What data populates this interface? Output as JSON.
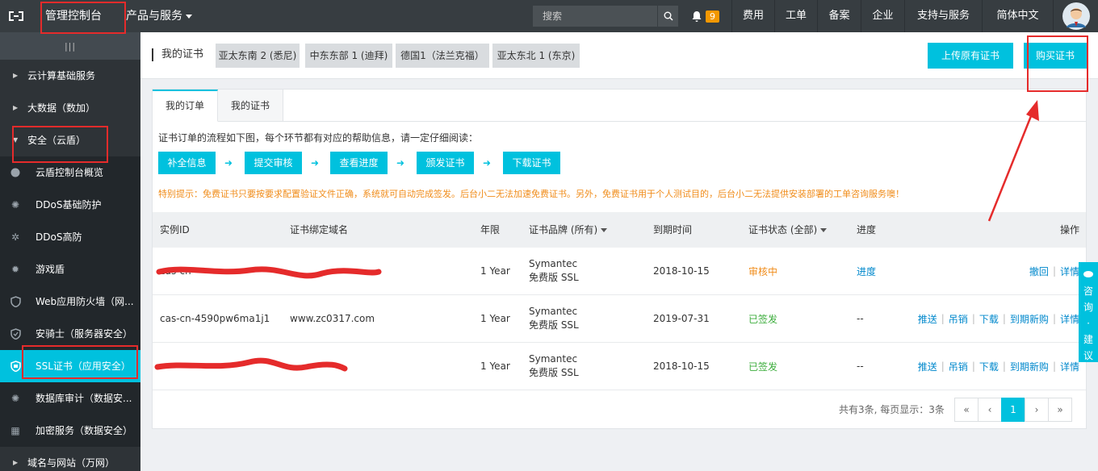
{
  "topbar": {
    "console": "管理控制台",
    "products": "产品与服务",
    "search_placeholder": "搜索",
    "notifications": "9",
    "nav": [
      "费用",
      "工单",
      "备案",
      "企业",
      "支持与服务",
      "简体中文"
    ]
  },
  "sidebar": {
    "groups": {
      "cloud": "云计算基础服务",
      "bigdata": "大数据（数加）",
      "security": "安全（云盾）",
      "domain": "域名与网站（万网）"
    },
    "items": [
      {
        "label": "云盾控制台概览",
        "icon": "circle-icon"
      },
      {
        "label": "DDoS基础防护",
        "icon": "gear-icon"
      },
      {
        "label": "DDoS高防",
        "icon": "gear-icon"
      },
      {
        "label": "游戏盾",
        "icon": "gear-icon"
      },
      {
        "label": "Web应用防火墙（网...",
        "icon": "shield-icon"
      },
      {
        "label": "安骑士（服务器安全）",
        "icon": "shield-icon"
      },
      {
        "label": "SSL证书（应用安全）",
        "icon": "certificate-icon"
      },
      {
        "label": "数据库审计（数据安...",
        "icon": "gear-icon"
      },
      {
        "label": "加密服务（数据安全）",
        "icon": "grid-icon"
      }
    ]
  },
  "page": {
    "title": "我的证书",
    "regions": [
      "亚太东南 2 (悉尼)",
      "中东东部 1 (迪拜)",
      "德国1（法兰克福）",
      "亚太东北 1 (东京)"
    ],
    "upload_button": "上传原有证书",
    "buy_button": "购买证书"
  },
  "tabs": [
    "我的订单",
    "我的证书"
  ],
  "intro": "证书订单的流程如下图，每个环节都有对应的帮助信息，请一定仔细阅读：",
  "steps": [
    "补全信息",
    "提交审核",
    "查看进度",
    "颁发证书",
    "下载证书"
  ],
  "notice": "特别提示：免费证书只要按要求配置验证文件正确，系统就可自动完成签发。后台小二无法加速免费证书。另外，免费证书用于个人测试目的，后台小二无法提供安装部署的工单咨询服务噢！",
  "table": {
    "headers": {
      "id": "实例ID",
      "domain": "证书绑定域名",
      "term": "年限",
      "brand": "证书品牌 (所有)",
      "expire": "到期时间",
      "status": "证书状态 (全部)",
      "progress": "进度",
      "ops": "操作"
    },
    "rows": [
      {
        "id": "cas-cn-",
        "domain": "",
        "term": "1 Year",
        "brand1": "Symantec",
        "brand2": "免费版 SSL",
        "expire": "2018-10-15",
        "status": "审核中",
        "progress": "进度",
        "ops": [
          "撤回",
          "详情"
        ]
      },
      {
        "id": "cas-cn-4590pw6ma1j1",
        "domain": "www.zc0317.com",
        "term": "1 Year",
        "brand1": "Symantec",
        "brand2": "免费版 SSL",
        "expire": "2019-07-31",
        "status": "已签发",
        "progress": "--",
        "ops": [
          "推送",
          "吊销",
          "下载",
          "到期新购",
          "详情"
        ]
      },
      {
        "id": "",
        "domain": "",
        "term": "1 Year",
        "brand1": "Symantec",
        "brand2": "免费版 SSL",
        "expire": "2018-10-15",
        "status": "已签发",
        "progress": "--",
        "ops": [
          "推送",
          "吊销",
          "下载",
          "到期新购",
          "详情"
        ]
      }
    ]
  },
  "pagination": {
    "summary": "共有3条, 每页显示：3条",
    "buttons": [
      "«",
      "‹",
      "1",
      "›",
      "»"
    ]
  },
  "consult": [
    "咨",
    "询",
    "·",
    "建",
    "议"
  ],
  "colors": {
    "accent": "#00c1de",
    "pending": "#f08c1a",
    "issued": "#3cad3c",
    "annotation": "#e52b2b"
  }
}
